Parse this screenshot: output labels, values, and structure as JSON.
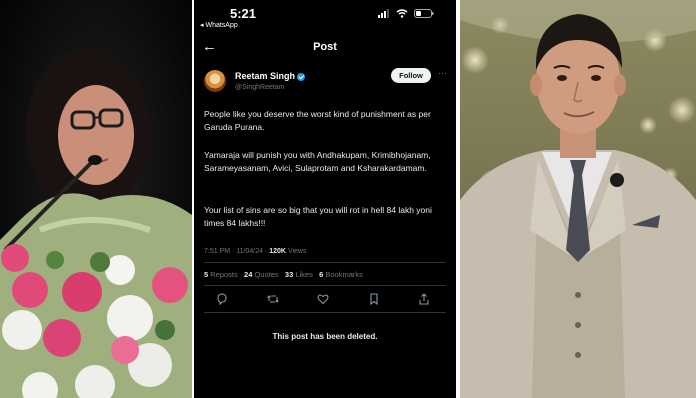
{
  "status_bar": {
    "time": "5:21",
    "back_app": "◂ WhatsApp"
  },
  "header": {
    "title": "Post"
  },
  "author": {
    "name": "Reetam Singh",
    "handle": "@SinghReetam",
    "follow_label": "Follow"
  },
  "post": {
    "paragraphs": [
      "People like you deserve the worst kind of punishment as per Garuda Purana.",
      "Yamaraja will punish you with Andhakupam, Krimibhojanam, Sarameyasanam, Avici, Sulaprotam and Ksharakardamam.",
      "Your list of sins are so big that you will rot in hell 84 lakh yoni times 84 lakhs!!!"
    ],
    "timestamp": "7:51 PM · 11/04/24 · ",
    "views_count": "120K",
    "views_label": " Views"
  },
  "stats": {
    "reposts_count": "5",
    "reposts_label": " Reposts",
    "quotes_count": "24",
    "quotes_label": " Quotes",
    "likes_count": "33",
    "likes_label": " Likes",
    "bookmarks_count": "6",
    "bookmarks_label": " Bookmarks"
  },
  "deleted_notice": "This post has been deleted.",
  "colors": {
    "phone_bg": "#000000",
    "text": "#e7e9ea",
    "muted": "#71767b",
    "verified": "#1d9bf0",
    "divider": "#2f3336"
  },
  "icons": [
    "back-arrow-icon",
    "signal-icon",
    "wifi-icon",
    "battery-icon",
    "verified-badge-icon",
    "more-icon",
    "reply-icon",
    "repost-icon",
    "like-icon",
    "bookmark-icon",
    "share-icon"
  ]
}
